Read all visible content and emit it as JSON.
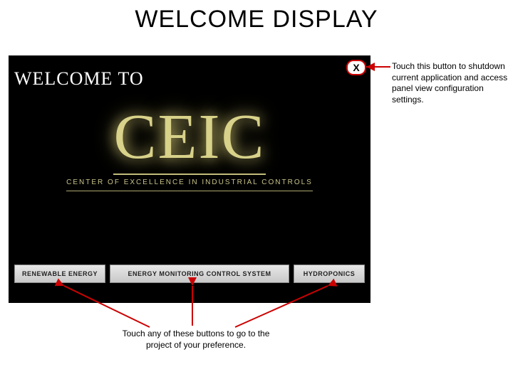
{
  "page": {
    "title": "WELCOME DISPLAY"
  },
  "screen": {
    "welcome_label": "WELCOME TO",
    "close_label": "X",
    "logo": {
      "main": "CEIC",
      "tagline": "CENTER OF EXCELLENCE IN INDUSTRIAL CONTROLS"
    },
    "buttons": {
      "renewable": "RENEWABLE ENERGY",
      "monitoring": "ENERGY MONITORING CONTROL SYSTEM",
      "hydroponics": "HYDROPONICS"
    }
  },
  "annotations": {
    "close": "Touch this button to shutdown current application and access panel view configuration settings.",
    "buttons": "Touch any of these buttons to go to the project of your preference."
  },
  "colors": {
    "callout_border": "#cc0000",
    "logo_glow": "#d8d28a"
  }
}
